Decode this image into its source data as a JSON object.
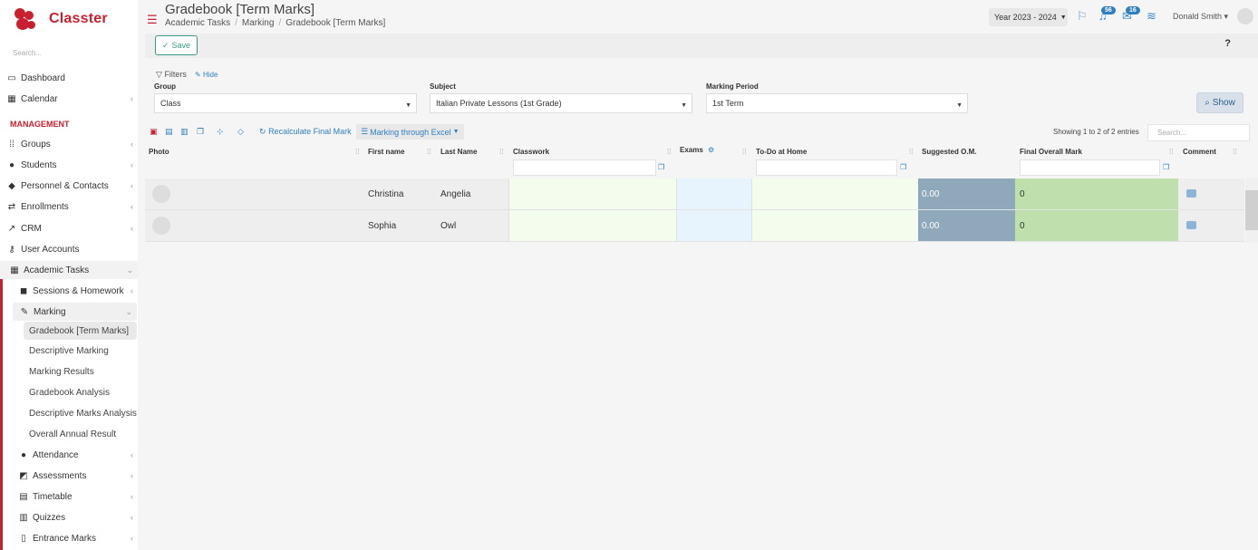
{
  "app": {
    "brand": "Classter",
    "sidebar_search_placeholder": "Search..."
  },
  "sidebar": {
    "section": "MANAGEMENT",
    "items": [
      {
        "label": "Dashboard",
        "icon": "laptop-icon"
      },
      {
        "label": "Calendar",
        "icon": "calendar-icon"
      },
      {
        "label": "Groups",
        "icon": "groups-icon"
      },
      {
        "label": "Students",
        "icon": "students-icon"
      },
      {
        "label": "Personnel & Contacts",
        "icon": "personnel-icon"
      },
      {
        "label": "Enrollments",
        "icon": "enrollments-icon"
      },
      {
        "label": "CRM",
        "icon": "crm-icon"
      },
      {
        "label": "User Accounts",
        "icon": "key-icon"
      },
      {
        "label": "Academic Tasks",
        "icon": "grid-icon"
      },
      {
        "label": "Sessions & Homework",
        "icon": "sessions-icon"
      },
      {
        "label": "Marking",
        "icon": "edit-icon"
      },
      {
        "label": "Attendance",
        "icon": "attendance-icon"
      },
      {
        "label": "Assessments",
        "icon": "assessments-icon"
      },
      {
        "label": "Timetable",
        "icon": "timetable-icon"
      },
      {
        "label": "Quizzes",
        "icon": "quizzes-icon"
      },
      {
        "label": "Entrance Marks",
        "icon": "entrance-icon"
      }
    ],
    "marking_sub": [
      "Gradebook [Term Marks]",
      "Descriptive Marking",
      "Marking Results",
      "Gradebook Analysis",
      "Descriptive Marks Analysis",
      "Overall Annual Result"
    ]
  },
  "header": {
    "title": "Gradebook [Term Marks]",
    "breadcrumb": [
      "Academic Tasks",
      "Marking",
      "Gradebook [Term Marks]"
    ],
    "year": "Year 2023 - 2024",
    "notif_count": "56",
    "msg_count": "16",
    "user": "Donald Smith"
  },
  "toolbar": {
    "save_label": "Save",
    "help_label": "?"
  },
  "filters": {
    "title": "Filters",
    "hide_label": "Hide",
    "group_label": "Group",
    "group_value": "Class",
    "subject_label": "Subject",
    "subject_value": "Italian Private Lessons (1st Grade)",
    "period_label": "Marking Period",
    "period_value": "1st Term",
    "show_label": "Show"
  },
  "grid": {
    "recalc_label": "Recalculate Final Mark",
    "excel_label": "Marking through Excel",
    "showing": "Showing 1 to 2 of 2 entries",
    "search_placeholder": "Search...",
    "columns": [
      "Photo",
      "First name",
      "Last Name",
      "Classwork",
      "Exams",
      "To-Do at Home",
      "Suggested O.M.",
      "Final Overall Mark",
      "Comment"
    ],
    "rows": [
      {
        "first": "Christina",
        "last": "Angelia",
        "suggested": "0.00",
        "final": "0"
      },
      {
        "first": "Sophia",
        "last": "Owl",
        "suggested": "0.00",
        "final": "0"
      }
    ]
  },
  "colors": {
    "brand": "#c8202f",
    "link": "#2f7fc0",
    "suggested_bg": "#90a9ba",
    "final_bg": "#bfe0ad",
    "classwork_bg": "#f3fced",
    "exams_bg": "#e8f4fd"
  }
}
